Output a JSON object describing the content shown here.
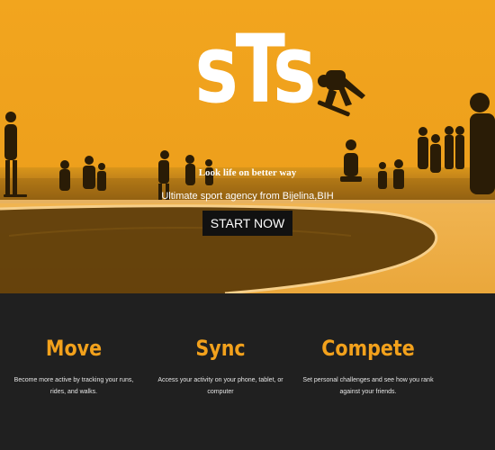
{
  "hero": {
    "logo": "sTs",
    "tagline": "Look life on better way",
    "subtitle": "Ultimate sport agency from Bijelina,BIH",
    "cta_label": "START NOW"
  },
  "features": [
    {
      "title": "Move",
      "text": "Become more active by tracking your runs, rides, and walks."
    },
    {
      "title": "Sync",
      "text": "Access your activity on your phone, tablet, or computer"
    },
    {
      "title": "Compete",
      "text": "Set personal challenges and see how you rank against your friends."
    }
  ],
  "colors": {
    "hero_orange": "#f2a51e",
    "accent": "#f2a11c",
    "dark_bg": "#202020",
    "button_bg": "#111111"
  }
}
